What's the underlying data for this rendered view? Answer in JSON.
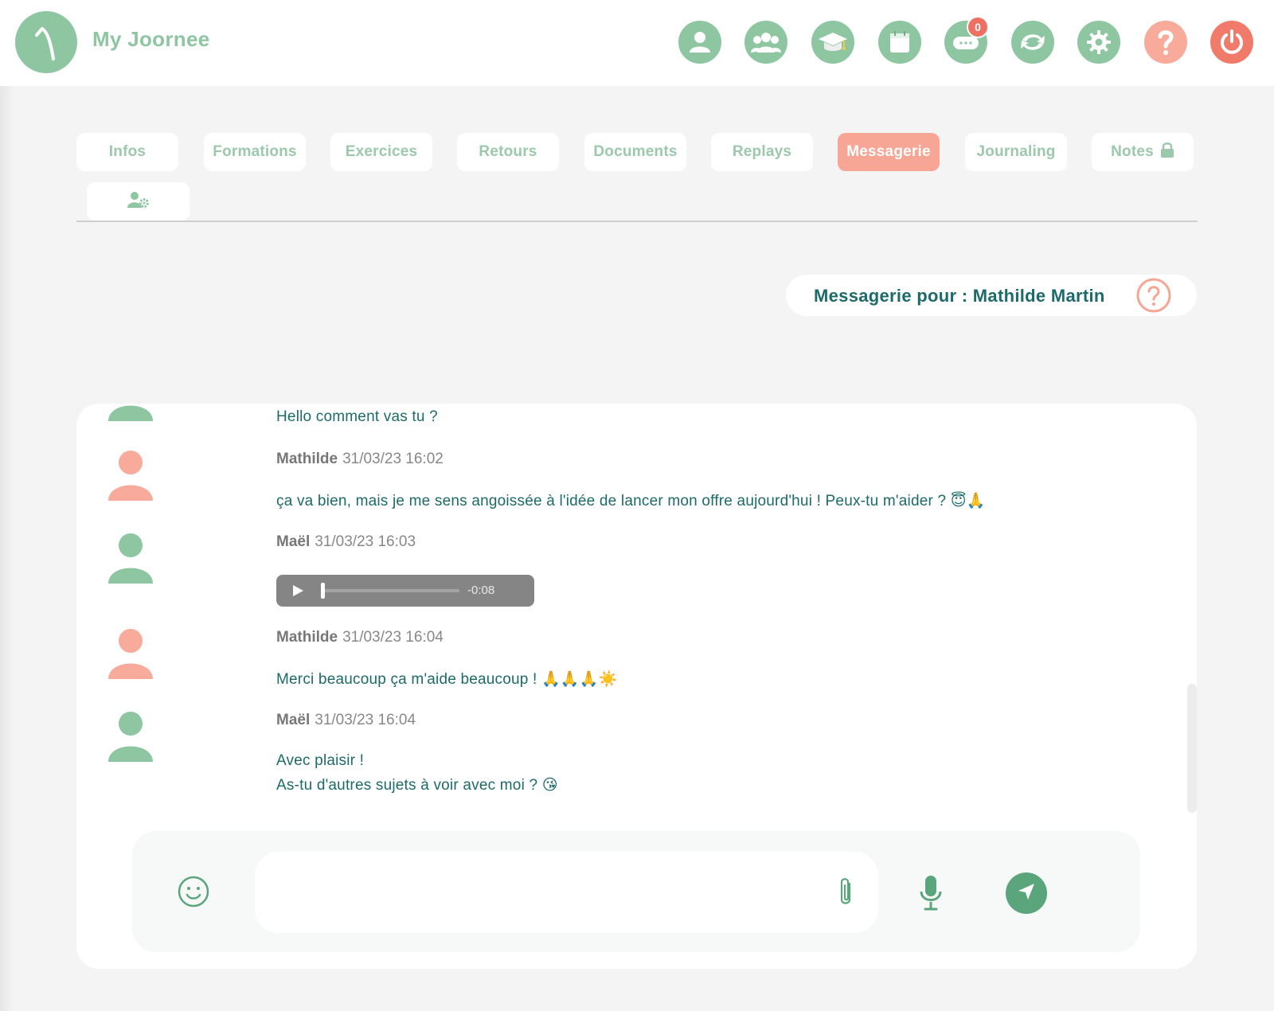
{
  "app": {
    "name": "My Joornee"
  },
  "header": {
    "nav_icons": [
      "profile-icon",
      "group-icon",
      "graduation-cap-icon",
      "calendar-icon",
      "chat-bubble-icon",
      "sync-icon",
      "gear-icon",
      "help-icon",
      "power-icon"
    ],
    "notification_count": "0"
  },
  "tabs": [
    {
      "label": "Infos",
      "active": false
    },
    {
      "label": "Formations",
      "active": false
    },
    {
      "label": "Exercices",
      "active": false
    },
    {
      "label": "Retours",
      "active": false
    },
    {
      "label": "Documents",
      "active": false
    },
    {
      "label": "Replays",
      "active": false
    },
    {
      "label": "Messagerie",
      "active": true
    },
    {
      "label": "Journaling",
      "active": false
    },
    {
      "label": "Notes",
      "active": false,
      "icon": "lock-icon"
    }
  ],
  "extra_tab": {
    "icon": "user-settings-icon"
  },
  "page": {
    "title": "Messagerie pour : Mathilde Martin"
  },
  "messages": [
    {
      "text": "Hello comment vas tu ?"
    },
    {
      "author": "Mathilde",
      "datetime": "31/03/23 16:02",
      "text": "ça va bien, mais je me sens angoissée à l'idée de lancer mon offre aujourd'hui ! Peux-tu m'aider ? 😇🙏"
    },
    {
      "author": "Maël",
      "datetime": "31/03/23 16:03",
      "audio": {
        "remaining": "-0:08",
        "progress": 0
      }
    },
    {
      "author": "Mathilde",
      "datetime": "31/03/23 16:04",
      "text": "Merci beaucoup ça m'aide beaucoup ! 🙏🙏🙏☀️"
    },
    {
      "author": "Maël",
      "datetime": "31/03/23 16:04",
      "text_line1": "Avec plaisir !",
      "text_line2": "As-tu d'autres sujets à voir avec moi ? 😘"
    }
  ],
  "composer": {
    "value": "",
    "placeholder": ""
  },
  "colors": {
    "brand_green": "#8ec6a2",
    "accent_salmon": "#f7a594",
    "text_teal": "#1c6a6a",
    "send_green": "#5aa57c"
  }
}
